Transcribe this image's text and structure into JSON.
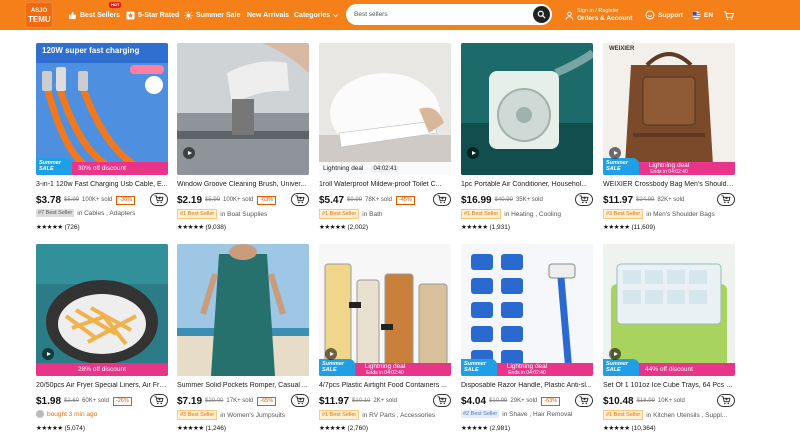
{
  "header": {
    "logo_top": "ASJO",
    "logo_bottom": "TEMU",
    "nav": [
      {
        "label": "Best Sellers",
        "badge": "HOT"
      },
      {
        "label": "5-Star Rated"
      },
      {
        "label": "Summer Sale"
      },
      {
        "label": "New Arrivals"
      },
      {
        "label": "Categories"
      }
    ],
    "search_placeholder": "Best sellers",
    "account_line1": "Sign in / Register",
    "account_line2": "Orders & Account",
    "support": "Support",
    "language": "EN",
    "accent_color": "#f57f18"
  },
  "products": [
    {
      "img_text": "120W super fast charging",
      "promo": "30% off discount",
      "summer": true,
      "title": "3-in-1 120w Fast Charging Usb Cable, E...",
      "price": "$3.78",
      "orig": "$5.99",
      "sold": "100K+ sold",
      "disc": "-36%",
      "badge": "#7 Best Seller",
      "badge_style": "gray",
      "cat": "in Cables , Adapters",
      "stars": "★★★★★",
      "reviews": "(726)",
      "video": false
    },
    {
      "promo": "",
      "summer": false,
      "title": "Window Groove Cleaning Brush, Univer...",
      "price": "$2.19",
      "orig": "$5.99",
      "sold": "100K+ sold",
      "disc": "-63%",
      "badge": "#1 Best Seller",
      "badge_style": "orange",
      "cat": "in Boat Supplies",
      "stars": "★★★★★",
      "reviews": "(9,038)",
      "video": true
    },
    {
      "promo": "Lightning deal",
      "timer": "04:02:41",
      "summer": false,
      "title": "1roll Waterproof Mildew-proof Toilet C...",
      "price": "$5.47",
      "orig": "$9.99",
      "sold": "78K+ sold",
      "disc": "-45%",
      "badge": "#1 Best Seller",
      "badge_style": "orange",
      "cat": "in Bath",
      "stars": "★★★★★",
      "reviews": "(2,002)",
      "video": false
    },
    {
      "promo": "",
      "summer": false,
      "title": "1pc Portable Air Conditioner, Househol...",
      "price": "$16.99",
      "orig": "$40.99",
      "sold": "35K+ sold",
      "disc": "",
      "badge": "#1 Best Seller",
      "badge_style": "orange",
      "cat": "in Heating , Cooling",
      "stars": "★★★★★",
      "reviews": "(1,931)",
      "video": true
    },
    {
      "img_text": "WEIXIER",
      "promo": "Lightning deal",
      "ends": "Ends in 04:02:40",
      "summer": true,
      "title": "WEIXIER Crossbody Bag Men's Shoulde...",
      "price": "$11.97",
      "orig": "$24.99",
      "sold": "82K+ sold",
      "disc": "",
      "badge": "#3 Best Seller",
      "badge_style": "orange",
      "cat": "in Men's Shoulder Bags",
      "stars": "★★★★★",
      "reviews": "(11,609)",
      "video": true
    },
    {
      "promo": "28% off discount",
      "summer": false,
      "title": "20/50pcs Air Fryer Special Liners, Air Fry...",
      "price": "$1.98",
      "orig": "$2.60",
      "sold": "60K+ sold",
      "disc": "-26%",
      "badge": "",
      "bought": "bought 3 min ago",
      "cat": "",
      "stars": "★★★★★",
      "reviews": "(5,074)",
      "video": true
    },
    {
      "promo": "",
      "summer": false,
      "title": "Summer Solid Pockets Romper, Casual ...",
      "price": "$7.19",
      "orig": "$20.00",
      "sold": "17K+ sold",
      "disc": "-65%",
      "badge": "#3 Best Seller",
      "badge_style": "orange",
      "cat": "in Women's Jumpsuits",
      "stars": "★★★★★",
      "reviews": "(1,246)",
      "video": false
    },
    {
      "promo": "Lightning deal",
      "ends": "Ends in 04:02:40",
      "summer": true,
      "title": "4/7pcs Plastic Airtight Food Containers ...",
      "price": "$11.97",
      "orig": "$10.10",
      "sold": "2K+ sold",
      "disc": "",
      "badge": "#1 Best Seller",
      "badge_style": "orange",
      "cat": "in RV Parts , Accessories",
      "stars": "★★★★★",
      "reviews": "(2,760)",
      "video": true
    },
    {
      "promo": "Lightning deal",
      "ends": "Ends in 04:02:40",
      "summer": true,
      "title": "Disposable Razor Handle, Plastic Anti-sl...",
      "price": "$4.04",
      "orig": "$10.99",
      "sold": "29K+ sold",
      "disc": "-63%",
      "badge": "#2 Best Seller",
      "badge_style": "blue",
      "cat": "in Shave , Hair Removal",
      "stars": "★★★★★",
      "reviews": "(2,981)",
      "video": false
    },
    {
      "promo": "44% off discount",
      "summer": true,
      "title": "Set Of 1 101oz Ice Cube Trays, 64 Pcs Si...",
      "price": "$10.48",
      "orig": "$18.99",
      "sold": "10K+ sold",
      "disc": "",
      "badge": "#1 Best Seller",
      "badge_style": "orange",
      "cat": "in Kitchen Utensils , Suppl...",
      "stars": "★★★★★",
      "reviews": "(10,364)",
      "video": true
    }
  ]
}
